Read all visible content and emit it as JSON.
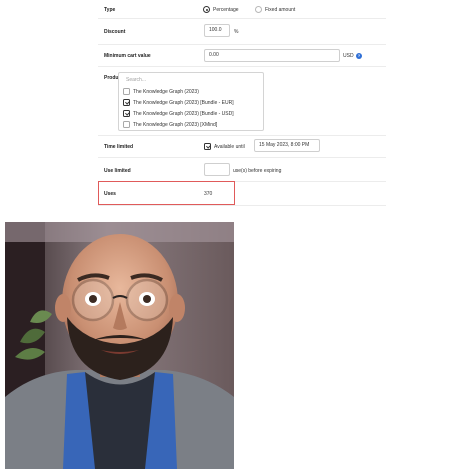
{
  "form": {
    "type": {
      "label": "Type",
      "option1": "Percentage",
      "option2": "Fixed amount",
      "selected": "Percentage"
    },
    "discount": {
      "label": "Discount",
      "value": "100.0",
      "unit": "%"
    },
    "min_cart": {
      "label": "Minimum cart value",
      "value": "0.00",
      "currency": "USD",
      "help_glyph": "?"
    },
    "product": {
      "label": "Product limited",
      "enabled": true,
      "search_placeholder": "Search...",
      "options": [
        {
          "label": "The Knowledge Graph (2023)",
          "checked": false
        },
        {
          "label": "The Knowledge Graph (2023) [Bundle - EUR]",
          "checked": true
        },
        {
          "label": "The Knowledge Graph (2023) [Bundle - USD]",
          "checked": true
        },
        {
          "label": "The Knowledge Graph (2023) [XMind]",
          "checked": false
        }
      ]
    },
    "time": {
      "label": "Time limited",
      "checked": true,
      "available_label": "Available until",
      "date_value": "15 May 2023, 8:00 PM"
    },
    "use": {
      "label": "Use limited",
      "value": "",
      "suffix": "use(s) before expiring"
    },
    "uses": {
      "label": "Uses",
      "value": "370"
    }
  },
  "photo": {
    "description_icon": "person-photo"
  },
  "colors": {
    "highlight": "#e05a5a",
    "help": "#2f6fd6"
  }
}
